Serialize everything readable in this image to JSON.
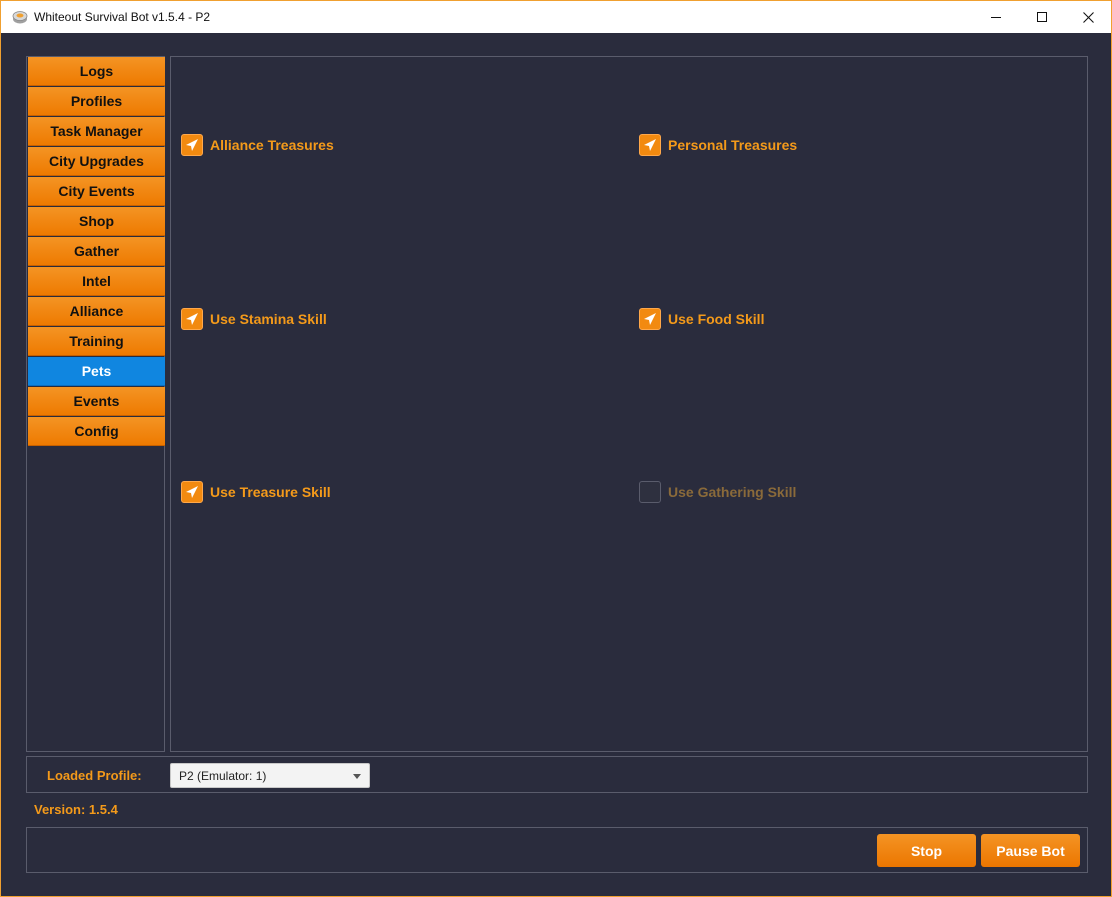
{
  "window": {
    "title": "Whiteout Survival Bot v1.5.4 - P2",
    "app_icon": "app-icon",
    "controls": [
      "minimize-icon",
      "maximize-icon",
      "close-icon"
    ]
  },
  "colors": {
    "accent": "#ee7a00",
    "active_tab": "#1086e0",
    "background": "#2a2c3d",
    "label": "#f49a1a"
  },
  "sidebar": {
    "items": [
      {
        "label": "Logs",
        "active": false
      },
      {
        "label": "Profiles",
        "active": false
      },
      {
        "label": "Task Manager",
        "active": false
      },
      {
        "label": "City Upgrades",
        "active": false
      },
      {
        "label": "City Events",
        "active": false
      },
      {
        "label": "Shop",
        "active": false
      },
      {
        "label": "Gather",
        "active": false
      },
      {
        "label": "Intel",
        "active": false
      },
      {
        "label": "Alliance",
        "active": false
      },
      {
        "label": "Training",
        "active": false
      },
      {
        "label": "Pets",
        "active": true
      },
      {
        "label": "Events",
        "active": false
      },
      {
        "label": "Config",
        "active": false
      }
    ]
  },
  "pets": {
    "options": [
      {
        "label": "Alliance Treasures",
        "checked": true,
        "enabled": true
      },
      {
        "label": "Personal Treasures",
        "checked": true,
        "enabled": true
      },
      {
        "label": "Use Stamina Skill",
        "checked": true,
        "enabled": true
      },
      {
        "label": "Use Food Skill",
        "checked": true,
        "enabled": true
      },
      {
        "label": "Use Treasure Skill",
        "checked": true,
        "enabled": true
      },
      {
        "label": "Use Gathering Skill",
        "checked": false,
        "enabled": false
      }
    ]
  },
  "profile": {
    "label": "Loaded Profile:",
    "selected": "P2 (Emulator: 1)"
  },
  "version_text": "Version: 1.5.4",
  "actions": {
    "stop_label": "Stop",
    "pause_label": "Pause Bot"
  }
}
